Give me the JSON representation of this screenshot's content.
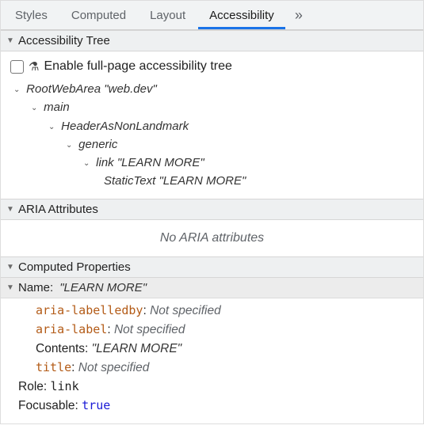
{
  "tabs": {
    "items": [
      "Styles",
      "Computed",
      "Layout",
      "Accessibility"
    ],
    "active_index": 3,
    "overflow_glyph": "»"
  },
  "sections": {
    "tree": {
      "title": "Accessibility Tree",
      "checkbox_label": "Enable full-page accessibility tree",
      "nodes": [
        {
          "depth": 1,
          "expandable": true,
          "role": "RootWebArea",
          "name": "\"web.dev\""
        },
        {
          "depth": 2,
          "expandable": true,
          "role": "main",
          "name": ""
        },
        {
          "depth": 3,
          "expandable": true,
          "role": "HeaderAsNonLandmark",
          "name": ""
        },
        {
          "depth": 4,
          "expandable": true,
          "role": "generic",
          "name": ""
        },
        {
          "depth": 5,
          "expandable": true,
          "role": "link",
          "name": "\"LEARN MORE\""
        },
        {
          "depth": 6,
          "expandable": false,
          "role": "StaticText",
          "name": "\"LEARN MORE\""
        }
      ]
    },
    "aria": {
      "title": "ARIA Attributes",
      "empty_text": "No ARIA attributes"
    },
    "computed": {
      "title": "Computed Properties",
      "name_label": "Name:",
      "name_value": "\"LEARN MORE\"",
      "sources": [
        {
          "key": "aria-labelledby",
          "value": "Not specified",
          "attrStyle": true
        },
        {
          "key": "aria-label",
          "value": "Not specified",
          "attrStyle": true
        },
        {
          "key": "Contents",
          "value": "\"LEARN MORE\"",
          "attrStyle": false,
          "literal": true
        },
        {
          "key": "title",
          "value": "Not specified",
          "attrStyle": true
        }
      ],
      "role_label": "Role:",
      "role_value": "link",
      "focusable_label": "Focusable:",
      "focusable_value": "true"
    }
  }
}
